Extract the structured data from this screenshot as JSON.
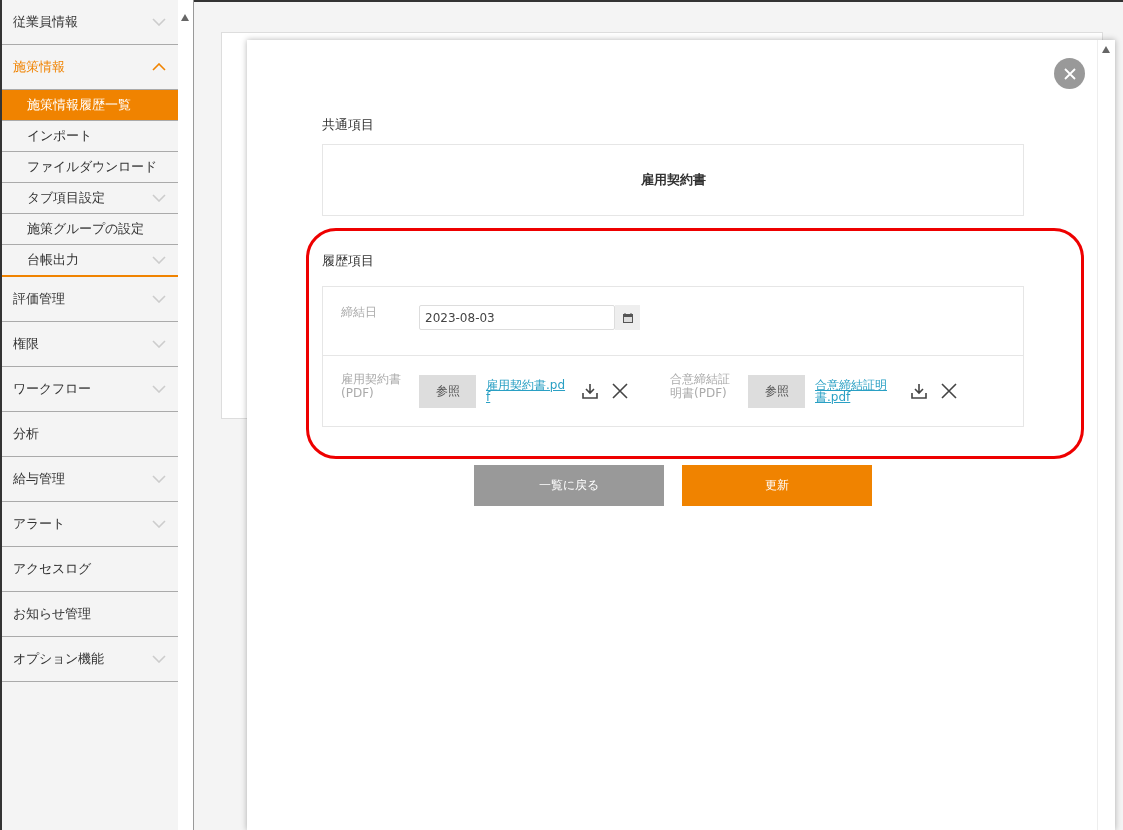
{
  "sidebar": {
    "items": [
      {
        "label": "従業員情報",
        "expandable": true,
        "expanded": false
      },
      {
        "label": "施策情報",
        "expandable": true,
        "expanded": true,
        "children": [
          {
            "label": "施策情報履歴一覧",
            "selected": true,
            "expandable": false
          },
          {
            "label": "インポート",
            "selected": false,
            "expandable": false
          },
          {
            "label": "ファイルダウンロード",
            "selected": false,
            "expandable": false
          },
          {
            "label": "タブ項目設定",
            "selected": false,
            "expandable": true
          },
          {
            "label": "施策グループの設定",
            "selected": false,
            "expandable": false
          },
          {
            "label": "台帳出力",
            "selected": false,
            "expandable": true
          }
        ]
      },
      {
        "label": "評価管理",
        "expandable": true,
        "expanded": false
      },
      {
        "label": "権限",
        "expandable": true,
        "expanded": false
      },
      {
        "label": "ワークフロー",
        "expandable": true,
        "expanded": false
      },
      {
        "label": "分析",
        "expandable": false,
        "expanded": false
      },
      {
        "label": "給与管理",
        "expandable": true,
        "expanded": false
      },
      {
        "label": "アラート",
        "expandable": true,
        "expanded": false
      },
      {
        "label": "アクセスログ",
        "expandable": false,
        "expanded": false
      },
      {
        "label": "お知らせ管理",
        "expandable": false,
        "expanded": false
      },
      {
        "label": "オプション機能",
        "expandable": true,
        "expanded": false
      }
    ]
  },
  "modal": {
    "common_section": {
      "title": "共通項目",
      "card_title": "雇用契約書"
    },
    "history_section": {
      "title": "履歴項目",
      "date_field": {
        "label": "締結日",
        "value": "2023-08-03"
      },
      "file_fields": [
        {
          "label": "雇用契約書(PDF)",
          "browse": "参照",
          "file": "雇用契約書.pdf"
        },
        {
          "label": "合意締結証明書(PDF)",
          "browse": "参照",
          "file": "合意締結証明書.pdf"
        }
      ]
    },
    "buttons": [
      {
        "label": "一覧に戻る",
        "kind": "secondary"
      },
      {
        "label": "更新",
        "kind": "primary"
      }
    ]
  }
}
